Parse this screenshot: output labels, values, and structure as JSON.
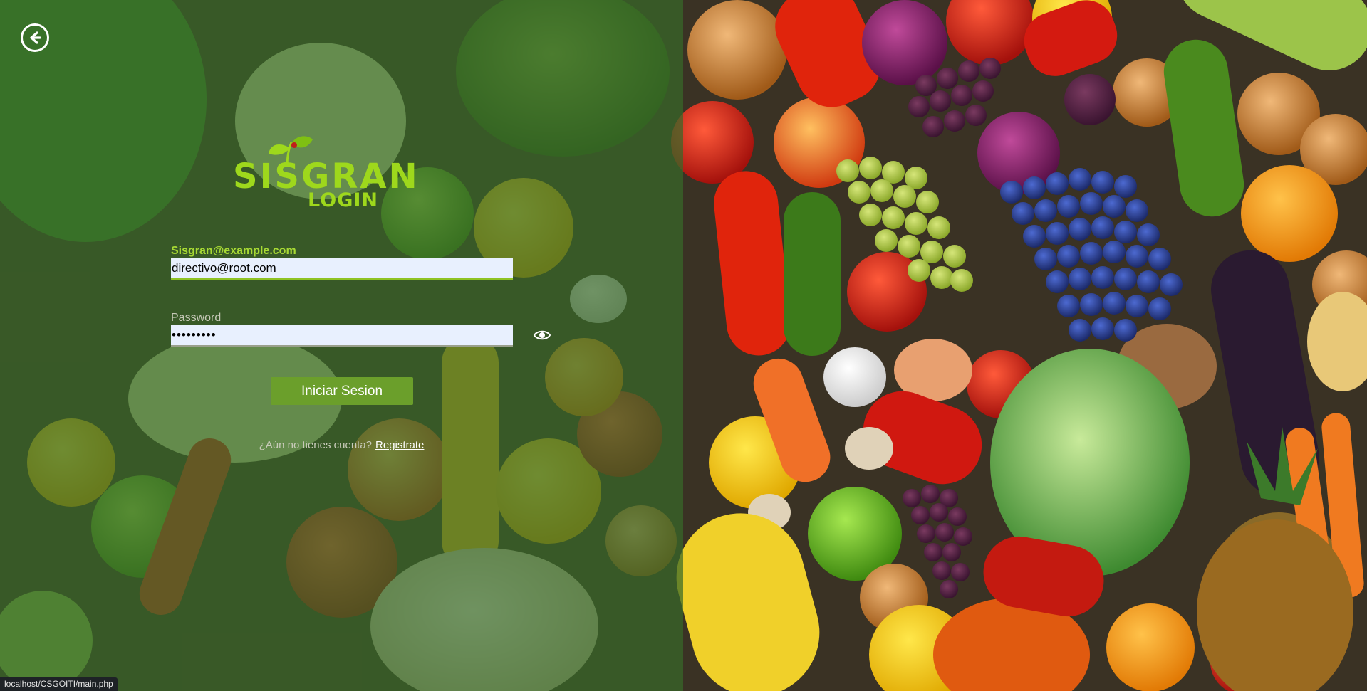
{
  "header": {
    "back_icon": "arrow-left-circle-icon"
  },
  "logo": {
    "brand": "SISGRAN",
    "subtitle": "LOGIN",
    "mascot_icon": "leaf-sprout-icon"
  },
  "form": {
    "email_label": "Sisgran@example.com",
    "email_value": "directivo@root.com",
    "password_label": "Password",
    "password_value": "secretpwd",
    "toggle_icon": "eye-icon",
    "submit_label": "Iniciar Sesion",
    "register_prompt": "¿Aún no tienes cuenta?",
    "register_link": "Registrate"
  },
  "status_bar": {
    "url": "localhost/CSGOITI/main.php"
  },
  "colors": {
    "accent": "#9ed81c",
    "button": "#6b9f2b",
    "panel": "#386828"
  }
}
